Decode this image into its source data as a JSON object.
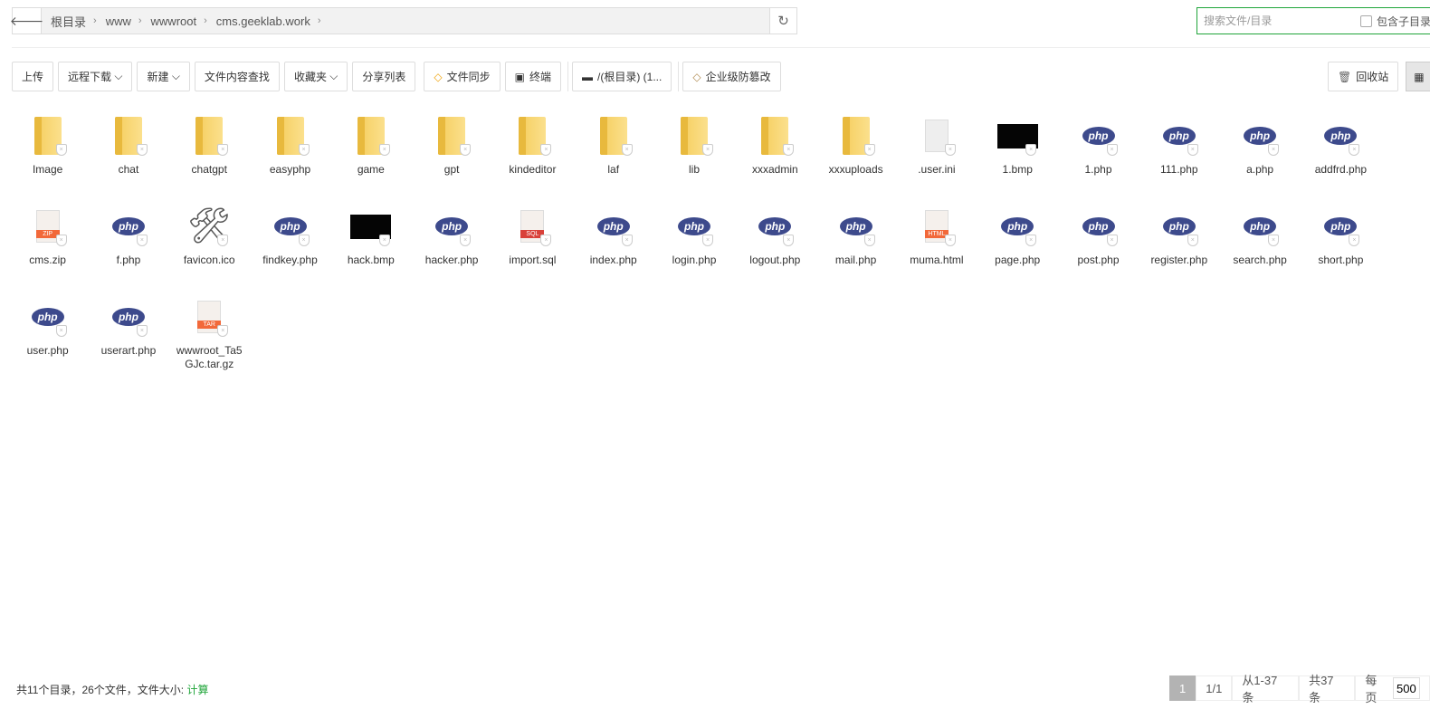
{
  "breadcrumb": {
    "items": [
      "根目录",
      "www",
      "wwwroot",
      "cms.geeklab.work"
    ]
  },
  "search": {
    "placeholder": "搜索文件/目录",
    "include_sub_label": "包含子目录"
  },
  "toolbar": {
    "upload": "上传",
    "remote_download": "远程下载",
    "new": "新建",
    "content_search": "文件内容查找",
    "favorites": "收藏夹",
    "share_list": "分享列表",
    "file_sync": "文件同步",
    "terminal": "终端",
    "disk": "/(根目录) (1...",
    "tamper": "企业级防篡改",
    "recycle": "回收站"
  },
  "files": [
    {
      "name": "Image",
      "type": "folder"
    },
    {
      "name": "chat",
      "type": "folder"
    },
    {
      "name": "chatgpt",
      "type": "folder"
    },
    {
      "name": "easyphp",
      "type": "folder"
    },
    {
      "name": "game",
      "type": "folder"
    },
    {
      "name": "gpt",
      "type": "folder"
    },
    {
      "name": "kindeditor",
      "type": "folder"
    },
    {
      "name": "laf",
      "type": "folder"
    },
    {
      "name": "lib",
      "type": "folder"
    },
    {
      "name": "xxxadmin",
      "type": "folder"
    },
    {
      "name": "xxxuploads",
      "type": "folder"
    },
    {
      "name": ".user.ini",
      "type": "ini"
    },
    {
      "name": "1.bmp",
      "type": "image"
    },
    {
      "name": "1.php",
      "type": "php"
    },
    {
      "name": "111.php",
      "type": "php"
    },
    {
      "name": "a.php",
      "type": "php"
    },
    {
      "name": "addfrd.php",
      "type": "php"
    },
    {
      "name": "cms.zip",
      "type": "zip"
    },
    {
      "name": "f.php",
      "type": "php"
    },
    {
      "name": "favicon.ico",
      "type": "ico"
    },
    {
      "name": "findkey.php",
      "type": "php"
    },
    {
      "name": "hack.bmp",
      "type": "image"
    },
    {
      "name": "hacker.php",
      "type": "php"
    },
    {
      "name": "import.sql",
      "type": "sql"
    },
    {
      "name": "index.php",
      "type": "php"
    },
    {
      "name": "login.php",
      "type": "php"
    },
    {
      "name": "logout.php",
      "type": "php"
    },
    {
      "name": "mail.php",
      "type": "php"
    },
    {
      "name": "muma.html",
      "type": "html"
    },
    {
      "name": "page.php",
      "type": "php"
    },
    {
      "name": "post.php",
      "type": "php"
    },
    {
      "name": "register.php",
      "type": "php"
    },
    {
      "name": "search.php",
      "type": "php"
    },
    {
      "name": "short.php",
      "type": "php"
    },
    {
      "name": "user.php",
      "type": "php"
    },
    {
      "name": "userart.php",
      "type": "php"
    },
    {
      "name": "wwwroot_Ta5GJc.tar.gz",
      "type": "tar"
    }
  ],
  "icon_labels": {
    "php": "php",
    "zip": "ZIP",
    "sql": "SQL",
    "html": "HTML",
    "tar": "TAR"
  },
  "footer": {
    "summary": "共11个目录，26个文件，文件大小: ",
    "calc": "计算"
  },
  "pager": {
    "current": "1",
    "pages": "1/1",
    "range": "从1-37条",
    "total": "共37条",
    "per_page_label": "每页",
    "per_page": "500"
  },
  "colors": {
    "accent": "#20a53a",
    "php": "#3d4a8c",
    "folder": "#f5cd5c"
  }
}
